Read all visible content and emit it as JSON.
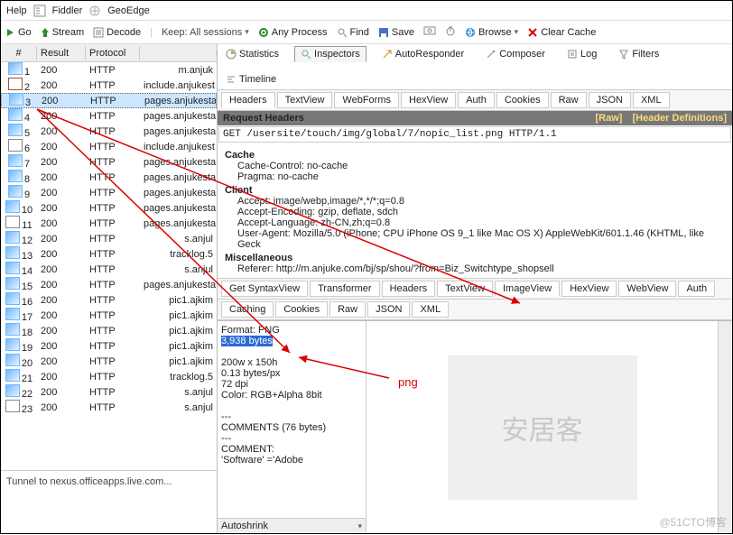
{
  "menubar": {
    "help": "Help",
    "fiddler": "Fiddler",
    "geoedge": "GeoEdge"
  },
  "toolbar": {
    "go": "Go",
    "stream": "Stream",
    "decode": "Decode",
    "keep": "Keep: All sessions",
    "any": "Any Process",
    "find": "Find",
    "save": "Save",
    "browse": "Browse",
    "clear": "Clear Cache"
  },
  "columns": {
    "n": "#",
    "result": "Result",
    "protocol": "Protocol"
  },
  "rows": [
    {
      "n": "1",
      "ico": "img",
      "r": "200",
      "p": "HTTP",
      "h": "m.anjuk"
    },
    {
      "n": "2",
      "ico": "css",
      "r": "200",
      "p": "HTTP",
      "h": "include.anjukest"
    },
    {
      "n": "3",
      "ico": "img",
      "r": "200",
      "p": "HTTP",
      "h": "pages.anjukesta",
      "sel": true
    },
    {
      "n": "4",
      "ico": "img",
      "r": "200",
      "p": "HTTP",
      "h": "pages.anjukesta"
    },
    {
      "n": "5",
      "ico": "img",
      "r": "200",
      "p": "HTTP",
      "h": "pages.anjukesta"
    },
    {
      "n": "6",
      "ico": "js",
      "r": "200",
      "p": "HTTP",
      "h": "include.anjukest"
    },
    {
      "n": "7",
      "ico": "img",
      "r": "200",
      "p": "HTTP",
      "h": "pages.anjukesta"
    },
    {
      "n": "8",
      "ico": "img",
      "r": "200",
      "p": "HTTP",
      "h": "pages.anjukesta"
    },
    {
      "n": "9",
      "ico": "img",
      "r": "200",
      "p": "HTTP",
      "h": "pages.anjukesta"
    },
    {
      "n": "10",
      "ico": "img",
      "r": "200",
      "p": "HTTP",
      "h": "pages.anjukesta"
    },
    {
      "n": "11",
      "ico": "js",
      "r": "200",
      "p": "HTTP",
      "h": "pages.anjukesta"
    },
    {
      "n": "12",
      "ico": "img",
      "r": "200",
      "p": "HTTP",
      "h": "s.anjul"
    },
    {
      "n": "13",
      "ico": "img",
      "r": "200",
      "p": "HTTP",
      "h": "tracklog.5"
    },
    {
      "n": "14",
      "ico": "img",
      "r": "200",
      "p": "HTTP",
      "h": "s.anjul"
    },
    {
      "n": "15",
      "ico": "img",
      "r": "200",
      "p": "HTTP",
      "h": "pages.anjukesta"
    },
    {
      "n": "16",
      "ico": "img",
      "r": "200",
      "p": "HTTP",
      "h": "pic1.ajkim"
    },
    {
      "n": "17",
      "ico": "img",
      "r": "200",
      "p": "HTTP",
      "h": "pic1.ajkim"
    },
    {
      "n": "18",
      "ico": "img",
      "r": "200",
      "p": "HTTP",
      "h": "pic1.ajkim"
    },
    {
      "n": "19",
      "ico": "img",
      "r": "200",
      "p": "HTTP",
      "h": "pic1.ajkim"
    },
    {
      "n": "20",
      "ico": "img",
      "r": "200",
      "p": "HTTP",
      "h": "pic1.ajkim"
    },
    {
      "n": "21",
      "ico": "img",
      "r": "200",
      "p": "HTTP",
      "h": "tracklog.5"
    },
    {
      "n": "22",
      "ico": "img",
      "r": "200",
      "p": "HTTP",
      "h": "s.anjul"
    },
    {
      "n": "23",
      "ico": "js",
      "r": "200",
      "p": "HTTP",
      "h": "s.anjul"
    }
  ],
  "footer": "Tunnel to     nexus.officeapps.live.com...",
  "topTabs": {
    "stats": "Statistics",
    "insp": "Inspectors",
    "auto": "AutoResponder",
    "comp": "Composer",
    "log": "Log",
    "filt": "Filters",
    "time": "Timeline"
  },
  "reqTabs": [
    "Headers",
    "TextView",
    "WebForms",
    "HexView",
    "Auth",
    "Cookies",
    "Raw",
    "JSON",
    "XML"
  ],
  "reqHeaderBar": {
    "title": "Request Headers",
    "raw": "[Raw]",
    "defs": "[Header Definitions]"
  },
  "requestLine": "GET /usersite/touch/img/global/7/nopic_list.png HTTP/1.1",
  "headers": {
    "Cache": {
      "Cache-Control": "no-cache",
      "Pragma": "no-cache"
    },
    "Client": {
      "Accept": "image/webp,image/*,*/*;q=0.8",
      "Accept-Encoding": "gzip, deflate, sdch",
      "Accept-Language": "zh-CN,zh;q=0.8",
      "User-Agent": "Mozilla/5.0 (iPhone; CPU iPhone OS 9_1 like Mac OS X) AppleWebKit/601.1.46 (KHTML, like Geck"
    },
    "Miscellaneous": {
      "Referer": "http://m.anjuke.com/bj/sp/shou/?from=Biz_Switchtype_shopsell"
    }
  },
  "respTabs1": [
    "Get SyntaxView",
    "Transformer",
    "Headers",
    "TextView",
    "ImageView",
    "HexView",
    "WebView",
    "Auth"
  ],
  "respTabs2": [
    "Caching",
    "Cookies",
    "Raw",
    "JSON",
    "XML"
  ],
  "imgInfo": {
    "format": "Format: PNG",
    "size": "3,938 bytes",
    "dim": "200w x 150h",
    "bpp": "0.13 bytes/px",
    "dpi": "72 dpi",
    "color": "Color: RGB+Alpha 8bit",
    "divider": "---",
    "comments": "COMMENTS (76 bytes)",
    "divider2": "---",
    "cmt": "COMMENT:",
    "sw": "'Software' ='Adobe"
  },
  "autoshrink": "Autoshrink",
  "preview": "安居客",
  "annotation": "png",
  "watermark": "@51CTO博客"
}
